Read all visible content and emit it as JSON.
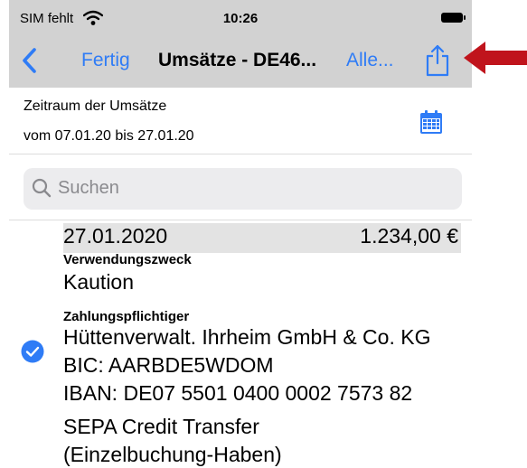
{
  "status": {
    "carrier": "SIM fehlt",
    "time": "10:26"
  },
  "nav": {
    "done_label": "Fertig",
    "title": "Umsätze - DE46...",
    "filter_label": "Alle..."
  },
  "range": {
    "title": "Zeitraum der Umsätze",
    "period": "vom 07.01.20 bis 27.01.20"
  },
  "search": {
    "placeholder": "Suchen"
  },
  "transaction": {
    "date": "27.01.2020",
    "amount": "1.234,00 €",
    "purpose_label": "Verwendungszweck",
    "purpose": "Kaution",
    "payer_label": "Zahlungspflichtiger",
    "payer_name": "Hüttenverwalt. Ihrheim GmbH & Co. KG",
    "bic": "BIC: AARBDE5WDOM",
    "iban": "IBAN: DE07 5501 0400 0002 7573 82",
    "type_line1": "SEPA Credit Transfer",
    "type_line2": "(Einzelbuchung-Haben)"
  },
  "colors": {
    "accent": "#2f7cf6",
    "navbar": "#d2d2d2",
    "annotation_arrow": "#c0141c"
  },
  "icons": [
    "wifi-icon",
    "battery-icon",
    "back-chevron-icon",
    "share-icon",
    "calendar-icon",
    "search-icon",
    "checkmark-icon",
    "annotation-arrow"
  ]
}
